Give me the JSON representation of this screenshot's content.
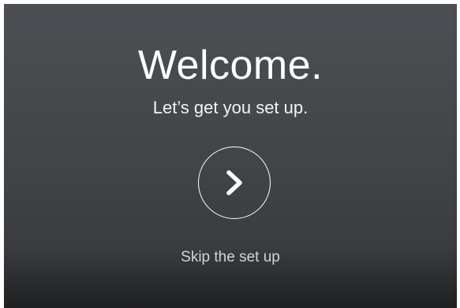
{
  "welcome": {
    "title": "Welcome.",
    "subtitle": "Let’s get you set up."
  },
  "actions": {
    "next_icon": "chevron-right-icon",
    "skip_label": "Skip the set up"
  },
  "colors": {
    "background_top": "#4c4f53",
    "background_bottom": "#1f2022",
    "text": "#ffffff",
    "muted_text": "#d2d4d6"
  }
}
